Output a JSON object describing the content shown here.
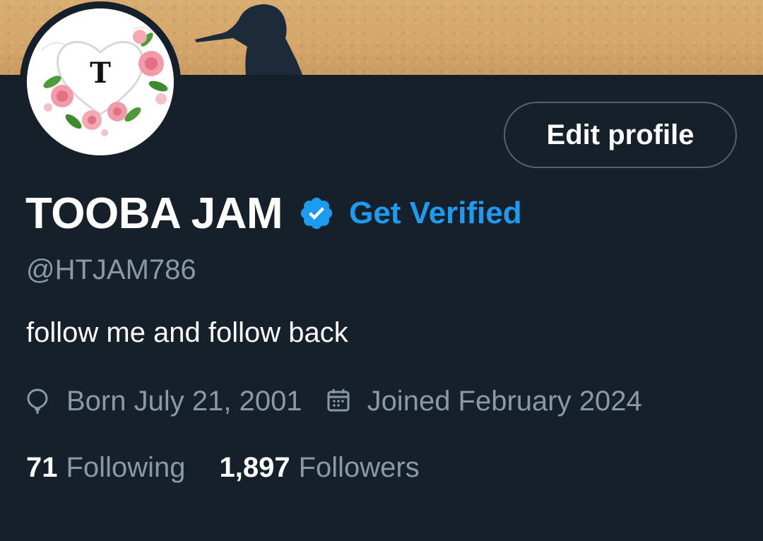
{
  "profile": {
    "avatar_letter": "T",
    "edit_button_label": "Edit profile",
    "display_name": "TOOBA JAM",
    "get_verified_label": "Get Verified",
    "handle": "@HTJAM786",
    "bio": "follow me and follow back",
    "born": "Born July 21, 2001",
    "joined": "Joined February 2024",
    "following_count": "71",
    "following_label": "Following",
    "followers_count": "1,897",
    "followers_label": "Followers"
  },
  "icons": {
    "verified": "verified-badge-icon",
    "born": "balloon-icon",
    "joined": "calendar-icon"
  },
  "colors": {
    "background": "#15202b",
    "accent": "#1d9bf0",
    "secondary_text": "#8b98a5",
    "banner": "#d4a66a"
  }
}
